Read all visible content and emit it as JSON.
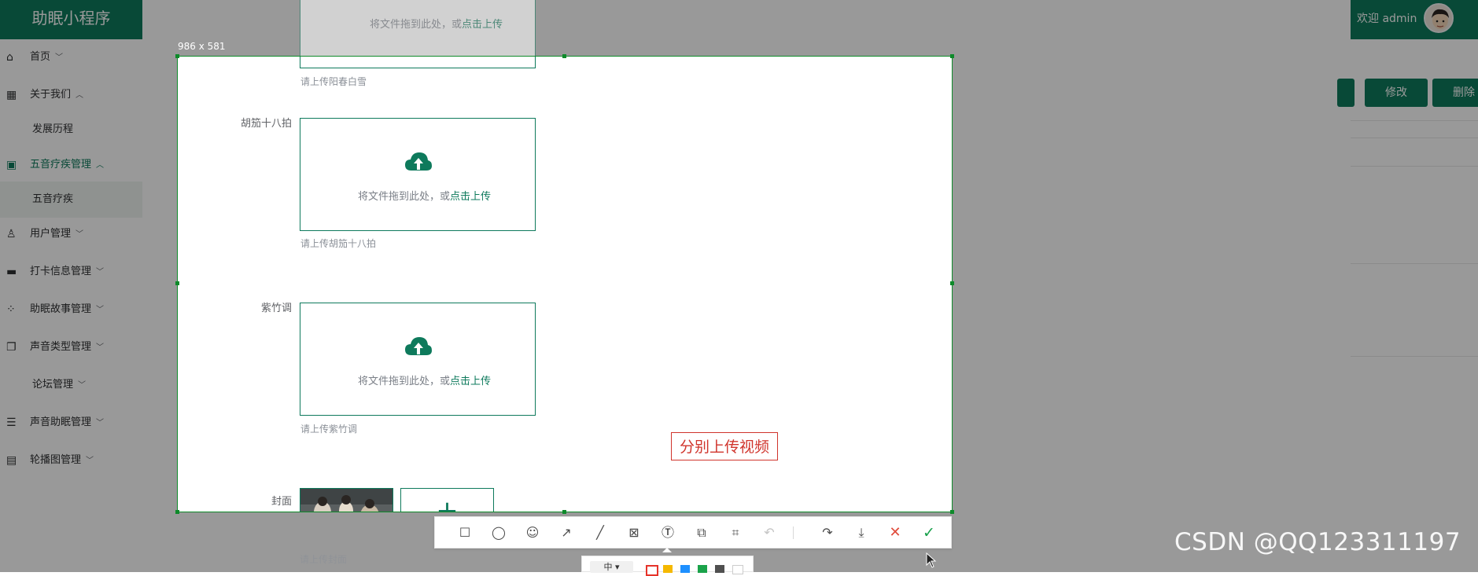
{
  "app": {
    "logo": "助眠小程序",
    "welcome": "欢迎 admin",
    "buttons": {
      "edit": "修改",
      "delete": "删除"
    }
  },
  "sidebar": {
    "items": [
      {
        "label": "首页",
        "icon": "home-icon",
        "chevron": "﹀"
      },
      {
        "label": "关于我们",
        "icon": "building-icon",
        "chevron": "︿"
      },
      {
        "label": "发展历程",
        "icon": "",
        "chevron": ""
      },
      {
        "label": "五音疗疾管理",
        "icon": "chip-icon",
        "chevron": "︿"
      },
      {
        "label": "五音疗疾",
        "icon": "",
        "chevron": ""
      },
      {
        "label": "用户管理",
        "icon": "user-icon",
        "chevron": "﹀"
      },
      {
        "label": "打卡信息管理",
        "icon": "book-icon",
        "chevron": "﹀"
      },
      {
        "label": "助眠故事管理",
        "icon": "grid-icon",
        "chevron": "﹀"
      },
      {
        "label": "声音类型管理",
        "icon": "copy-icon",
        "chevron": "﹀"
      },
      {
        "label": "论坛管理",
        "icon": "",
        "chevron": "﹀"
      },
      {
        "label": "声音助眠管理",
        "icon": "server-icon",
        "chevron": "﹀"
      },
      {
        "label": "轮播图管理",
        "icon": "table-icon",
        "chevron": "﹀"
      }
    ]
  },
  "capture": {
    "size_label": "986 x 581",
    "upload_hint_text": "将文件拖到此处，或",
    "upload_hint_link": "点击上传",
    "fields": [
      {
        "label": "",
        "tip": "请上传阳春白雪"
      },
      {
        "label": "胡笳十八拍",
        "tip": "请上传胡笳十八拍"
      },
      {
        "label": "紫竹调",
        "tip": "请上传紫竹调"
      }
    ],
    "cover": {
      "label": "封面",
      "tip": "请上传封面",
      "add": "+"
    },
    "annotation": "分别上传视频"
  },
  "toolbar": {
    "tools": [
      {
        "name": "rectangle-tool-icon",
        "glyph": "☐",
        "disabled": false
      },
      {
        "name": "ellipse-tool-icon",
        "glyph": "◯",
        "disabled": false
      },
      {
        "name": "emoji-tool-icon",
        "glyph": "☺",
        "disabled": false
      },
      {
        "name": "arrow-tool-icon",
        "glyph": "↗",
        "disabled": false
      },
      {
        "name": "line-tool-icon",
        "glyph": "╱",
        "disabled": false
      },
      {
        "name": "mosaic-tool-icon",
        "glyph": "⊠",
        "disabled": false
      },
      {
        "name": "text-tool-icon",
        "glyph": "Ⓣ",
        "disabled": false
      },
      {
        "name": "sticker-tool-icon",
        "glyph": "⧉",
        "disabled": false
      },
      {
        "name": "ocr-tool-icon",
        "glyph": "⌗",
        "disabled": false
      },
      {
        "name": "undo-icon",
        "glyph": "↶",
        "disabled": true
      },
      {
        "name": "share-icon",
        "glyph": "↷",
        "disabled": false
      },
      {
        "name": "download-icon",
        "glyph": "⤓",
        "disabled": false
      },
      {
        "name": "cancel-icon",
        "glyph": "✕",
        "disabled": false
      },
      {
        "name": "confirm-icon",
        "glyph": "✓",
        "disabled": false
      }
    ],
    "font_size": "中 ▾",
    "colors": [
      "#e6332a",
      "#f5b800",
      "#1e90ff",
      "#1aa34a",
      "#505050",
      "#ffffff"
    ],
    "active_color": "#e6332a"
  },
  "watermark": "CSDN @QQ123311197"
}
